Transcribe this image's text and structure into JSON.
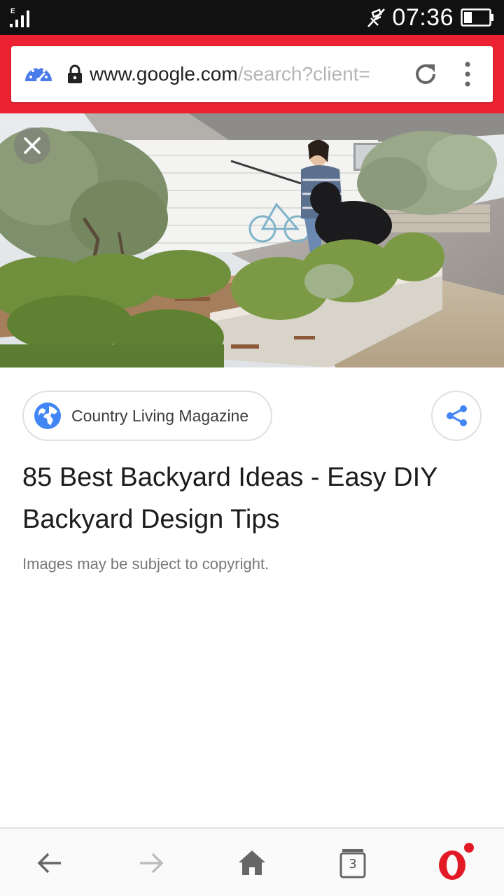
{
  "status_bar": {
    "network_type": "E",
    "time": "07:36"
  },
  "browser": {
    "url_host": "www.google.com",
    "url_path": "/search?client=",
    "icons": [
      "speed-dial-icon",
      "lock-icon",
      "reload-icon",
      "overflow-menu-icon"
    ]
  },
  "viewer": {
    "close_icon": "close-icon",
    "source_name": "Country Living Magazine",
    "title": "85 Best Backyard Ideas - Easy DIY Backyard Design Tips",
    "copyright_note": "Images may be subject to copyright."
  },
  "bottom_nav": {
    "tab_count": "3",
    "icons": [
      "back-arrow-icon",
      "forward-arrow-icon",
      "home-icon",
      "tabs-icon",
      "opera-icon"
    ]
  },
  "colors": {
    "browser_bar": "#ec2233",
    "accent_blue": "#4285f4",
    "status_bar": "#111111"
  }
}
